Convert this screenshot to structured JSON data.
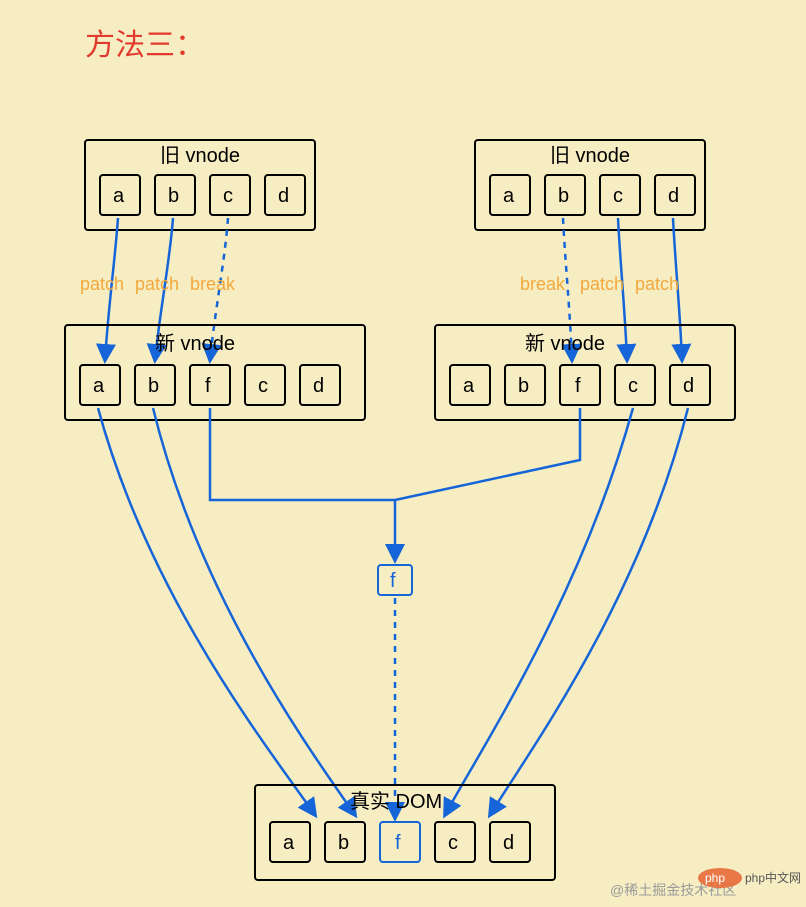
{
  "title": "方法三：",
  "old_vnode_label": "旧 vnode",
  "new_vnode_label": "新 vnode",
  "real_dom_label": "真实 DOM",
  "old_cells": [
    "a",
    "b",
    "c",
    "d"
  ],
  "new_cells": [
    "a",
    "b",
    "f",
    "c",
    "d"
  ],
  "dom_cells": [
    "a",
    "b",
    "f",
    "c",
    "d"
  ],
  "new_node": "f",
  "annotations_left": [
    "patch",
    "patch",
    "break"
  ],
  "annotations_right": [
    "break",
    "patch",
    "patch"
  ],
  "watermark": "@稀土掘金技术社区",
  "watermark2": "php中文网"
}
